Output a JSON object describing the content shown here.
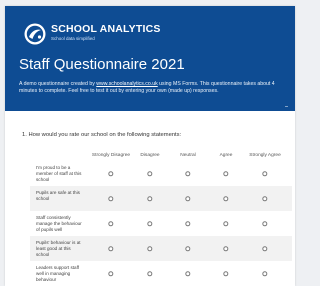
{
  "brand": {
    "name": "SCHOOL ANALYTICS",
    "tagline": "School data simplified"
  },
  "form": {
    "title": "Staff Questionnaire 2021",
    "description_before": "A demo questionnaire created by ",
    "description_link": "www.schoolanalytics.co.uk",
    "description_after": " using MS Forms. This questionnaire takes about 4 minutes to complete. Feel free to test it out by entering your own (made up) responses.",
    "more_label": "..."
  },
  "question": {
    "label": "1. How would you rate our school on the following statements:",
    "columns": [
      "Strongly Disagree",
      "Disagree",
      "Neutral",
      "Agree",
      "Strongly Agree"
    ],
    "statements": [
      "I'm proud to be a member of staff at this school",
      "Pupils are safe at this school",
      " Staff consistently manage the behaviour of pupils well",
      "Pupils' behaviour is at least good at this school",
      "Leaders support staff well in managing behaviour"
    ]
  }
}
